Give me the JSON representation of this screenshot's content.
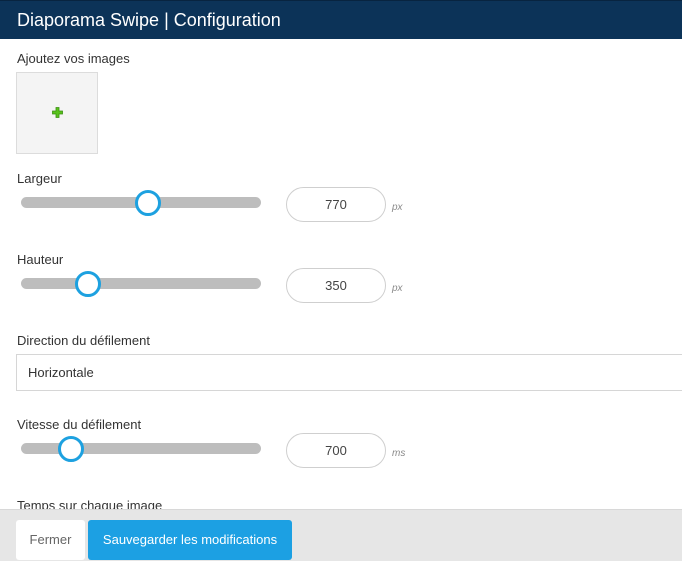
{
  "window": {
    "title": "Diaporama Swipe | Configuration"
  },
  "images": {
    "label": "Ajoutez vos images",
    "add_icon": "plus-icon"
  },
  "width": {
    "label": "Largeur",
    "value": "770",
    "unit": "px",
    "slider_fraction": 0.53
  },
  "height": {
    "label": "Hauteur",
    "value": "350",
    "unit": "px",
    "slider_fraction": 0.28
  },
  "direction": {
    "label": "Direction du défilement",
    "selected": "Horizontale"
  },
  "speed": {
    "label": "Vitesse du défilement",
    "value": "700",
    "unit": "ms",
    "slider_fraction": 0.21
  },
  "time": {
    "label": "Temps sur chaque image"
  },
  "footer": {
    "close_label": "Fermer",
    "save_label": "Sauvegarder les modifications"
  },
  "colors": {
    "header_bg": "#0c3358",
    "accent": "#1ca0e3",
    "plus_green": "#58c21b"
  }
}
